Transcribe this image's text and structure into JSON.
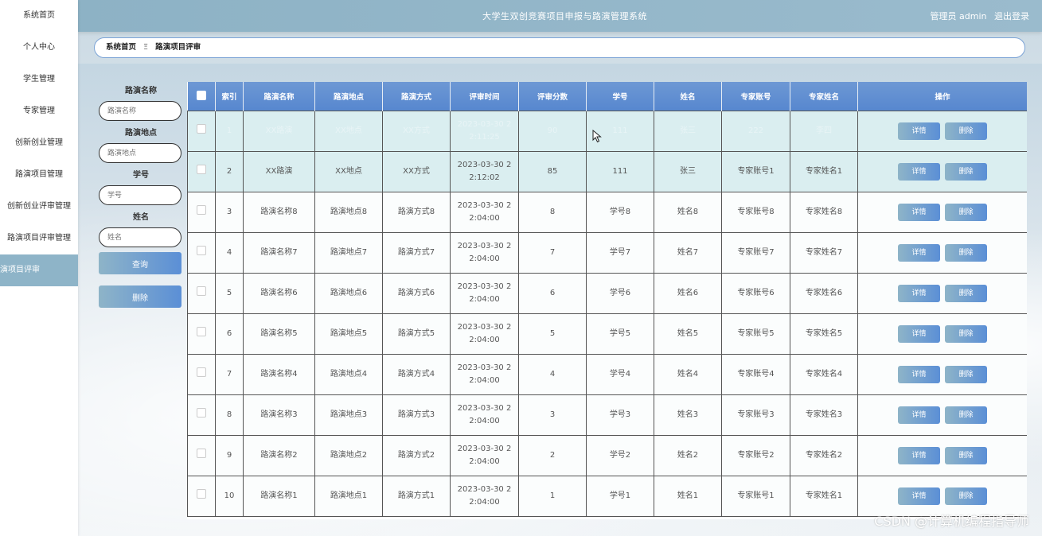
{
  "header": {
    "title": "大学生双创竞赛项目申报与路演管理系统",
    "user": "管理员 admin",
    "logout": "退出登录"
  },
  "sidebar": {
    "items": [
      {
        "label": "系统首页"
      },
      {
        "label": "个人中心"
      },
      {
        "label": "学生管理"
      },
      {
        "label": "专家管理"
      },
      {
        "label": "创新创业管理"
      },
      {
        "label": "路演项目管理"
      },
      {
        "label": "创新创业评审管理"
      },
      {
        "label": "路演项目评审管理"
      },
      {
        "label": "路演项目评审"
      }
    ]
  },
  "breadcrumb": {
    "home": "系统首页",
    "separator": "Ξ",
    "current": "路演项目评审"
  },
  "search": {
    "fields": [
      {
        "label": "路演名称",
        "placeholder": "路演名称"
      },
      {
        "label": "路演地点",
        "placeholder": "路演地点"
      },
      {
        "label": "学号",
        "placeholder": "学号"
      },
      {
        "label": "姓名",
        "placeholder": "姓名"
      }
    ],
    "query_button": "查询",
    "delete_button": "删除"
  },
  "table": {
    "headers": [
      "索引",
      "路演名称",
      "路演地点",
      "路演方式",
      "评审时间",
      "评审分数",
      "学号",
      "姓名",
      "专家账号",
      "专家姓名",
      "操作"
    ],
    "detail_label": "详情",
    "delete_label": "删除",
    "rows": [
      {
        "index": "1",
        "name": "XX路演",
        "place": "XX地点",
        "mode": "XX方式",
        "time": "2023-03-30 2 2:11:25",
        "score": "90",
        "sno": "111",
        "sname": "张三",
        "eno": "222",
        "ename": "李四"
      },
      {
        "index": "2",
        "name": "XX路演",
        "place": "XX地点",
        "mode": "XX方式",
        "time": "2023-03-30 2 2:12:02",
        "score": "85",
        "sno": "111",
        "sname": "张三",
        "eno": "专家账号1",
        "ename": "专家姓名1"
      },
      {
        "index": "3",
        "name": "路演名称8",
        "place": "路演地点8",
        "mode": "路演方式8",
        "time": "2023-03-30 2 2:04:00",
        "score": "8",
        "sno": "学号8",
        "sname": "姓名8",
        "eno": "专家账号8",
        "ename": "专家姓名8"
      },
      {
        "index": "4",
        "name": "路演名称7",
        "place": "路演地点7",
        "mode": "路演方式7",
        "time": "2023-03-30 2 2:04:00",
        "score": "7",
        "sno": "学号7",
        "sname": "姓名7",
        "eno": "专家账号7",
        "ename": "专家姓名7"
      },
      {
        "index": "5",
        "name": "路演名称6",
        "place": "路演地点6",
        "mode": "路演方式6",
        "time": "2023-03-30 2 2:04:00",
        "score": "6",
        "sno": "学号6",
        "sname": "姓名6",
        "eno": "专家账号6",
        "ename": "专家姓名6"
      },
      {
        "index": "6",
        "name": "路演名称5",
        "place": "路演地点5",
        "mode": "路演方式5",
        "time": "2023-03-30 2 2:04:00",
        "score": "5",
        "sno": "学号5",
        "sname": "姓名5",
        "eno": "专家账号5",
        "ename": "专家姓名5"
      },
      {
        "index": "7",
        "name": "路演名称4",
        "place": "路演地点4",
        "mode": "路演方式4",
        "time": "2023-03-30 2 2:04:00",
        "score": "4",
        "sno": "学号4",
        "sname": "姓名4",
        "eno": "专家账号4",
        "ename": "专家姓名4"
      },
      {
        "index": "8",
        "name": "路演名称3",
        "place": "路演地点3",
        "mode": "路演方式3",
        "time": "2023-03-30 2 2:04:00",
        "score": "3",
        "sno": "学号3",
        "sname": "姓名3",
        "eno": "专家账号3",
        "ename": "专家姓名3"
      },
      {
        "index": "9",
        "name": "路演名称2",
        "place": "路演地点2",
        "mode": "路演方式2",
        "time": "2023-03-30 2 2:04:00",
        "score": "2",
        "sno": "学号2",
        "sname": "姓名2",
        "eno": "专家账号2",
        "ename": "专家姓名2"
      },
      {
        "index": "10",
        "name": "路演名称1",
        "place": "路演地点1",
        "mode": "路演方式1",
        "time": "2023-03-30 2 2:04:00",
        "score": "1",
        "sno": "学号1",
        "sname": "姓名1",
        "eno": "专家账号1",
        "ename": "专家姓名1"
      }
    ]
  },
  "watermark": "CSDN @计算机编程指导师"
}
